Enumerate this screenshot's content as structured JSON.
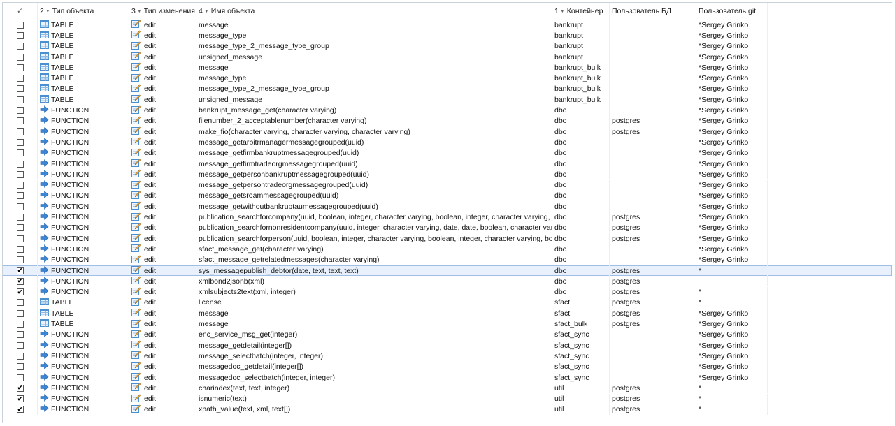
{
  "columns": {
    "check": "✓",
    "type_num": "2",
    "type_label": "Тип объекта",
    "change_num": "3",
    "change_label": "Тип изменения",
    "name_num": "4",
    "name_label": "Имя объекта",
    "container_num": "1",
    "container_label": "Контейнер",
    "dbuser_label": "Пользователь БД",
    "gituser_label": "Пользователь git"
  },
  "icons": {
    "table": "table-icon",
    "function": "function-arrow-icon",
    "edit": "edit-pencil-icon",
    "sort": "sort-triangle-icon"
  },
  "colors": {
    "selected_row": "#e8f0fb",
    "selected_border": "#9fbde6",
    "grid_line": "#eceef1",
    "function_icon": "#3b86d6"
  },
  "rows": [
    {
      "checked": false,
      "type": "TABLE",
      "change": "edit",
      "name": "message",
      "container": "bankrupt",
      "db_user": "",
      "git_user": "*Sergey Grinko"
    },
    {
      "checked": false,
      "type": "TABLE",
      "change": "edit",
      "name": "message_type",
      "container": "bankrupt",
      "db_user": "",
      "git_user": "*Sergey Grinko"
    },
    {
      "checked": false,
      "type": "TABLE",
      "change": "edit",
      "name": "message_type_2_message_type_group",
      "container": "bankrupt",
      "db_user": "",
      "git_user": "*Sergey Grinko"
    },
    {
      "checked": false,
      "type": "TABLE",
      "change": "edit",
      "name": "unsigned_message",
      "container": "bankrupt",
      "db_user": "",
      "git_user": "*Sergey Grinko"
    },
    {
      "checked": false,
      "type": "TABLE",
      "change": "edit",
      "name": "message",
      "container": "bankrupt_bulk",
      "db_user": "",
      "git_user": "*Sergey Grinko"
    },
    {
      "checked": false,
      "type": "TABLE",
      "change": "edit",
      "name": "message_type",
      "container": "bankrupt_bulk",
      "db_user": "",
      "git_user": "*Sergey Grinko"
    },
    {
      "checked": false,
      "type": "TABLE",
      "change": "edit",
      "name": "message_type_2_message_type_group",
      "container": "bankrupt_bulk",
      "db_user": "",
      "git_user": "*Sergey Grinko"
    },
    {
      "checked": false,
      "type": "TABLE",
      "change": "edit",
      "name": "unsigned_message",
      "container": "bankrupt_bulk",
      "db_user": "",
      "git_user": "*Sergey Grinko"
    },
    {
      "checked": false,
      "type": "FUNCTION",
      "change": "edit",
      "name": "bankrupt_message_get(character varying)",
      "container": "dbo",
      "db_user": "",
      "git_user": "*Sergey Grinko"
    },
    {
      "checked": false,
      "type": "FUNCTION",
      "change": "edit",
      "name": "filenumber_2_acceptablenumber(character varying)",
      "container": "dbo",
      "db_user": "postgres",
      "git_user": "*Sergey Grinko"
    },
    {
      "checked": false,
      "type": "FUNCTION",
      "change": "edit",
      "name": "make_fio(character varying, character varying, character varying)",
      "container": "dbo",
      "db_user": "postgres",
      "git_user": "*Sergey Grinko"
    },
    {
      "checked": false,
      "type": "FUNCTION",
      "change": "edit",
      "name": "message_getarbitrmanagermessagegrouped(uuid)",
      "container": "dbo",
      "db_user": "",
      "git_user": "*Sergey Grinko"
    },
    {
      "checked": false,
      "type": "FUNCTION",
      "change": "edit",
      "name": "message_getfirmbankruptmessagegrouped(uuid)",
      "container": "dbo",
      "db_user": "",
      "git_user": "*Sergey Grinko"
    },
    {
      "checked": false,
      "type": "FUNCTION",
      "change": "edit",
      "name": "message_getfirmtradeorgmessagegrouped(uuid)",
      "container": "dbo",
      "db_user": "",
      "git_user": "*Sergey Grinko"
    },
    {
      "checked": false,
      "type": "FUNCTION",
      "change": "edit",
      "name": "message_getpersonbankruptmessagegrouped(uuid)",
      "container": "dbo",
      "db_user": "",
      "git_user": "*Sergey Grinko"
    },
    {
      "checked": false,
      "type": "FUNCTION",
      "change": "edit",
      "name": "message_getpersontradeorgmessagegrouped(uuid)",
      "container": "dbo",
      "db_user": "",
      "git_user": "*Sergey Grinko"
    },
    {
      "checked": false,
      "type": "FUNCTION",
      "change": "edit",
      "name": "message_getsroammessagegrouped(uuid)",
      "container": "dbo",
      "db_user": "",
      "git_user": "*Sergey Grinko"
    },
    {
      "checked": false,
      "type": "FUNCTION",
      "change": "edit",
      "name": "message_getwithoutbankruptaumessagegrouped(uuid)",
      "container": "dbo",
      "db_user": "",
      "git_user": "*Sergey Grinko"
    },
    {
      "checked": false,
      "type": "FUNCTION",
      "change": "edit",
      "name": "publication_searchforcompany(uuid, boolean, integer, character varying, boolean, integer, character varying, bo",
      "container": "dbo",
      "db_user": "postgres",
      "git_user": "*Sergey Grinko"
    },
    {
      "checked": false,
      "type": "FUNCTION",
      "change": "edit",
      "name": "publication_searchfornonresidentcompany(uuid, integer, character varying, date, date, boolean, character varyir",
      "container": "dbo",
      "db_user": "postgres",
      "git_user": "*Sergey Grinko"
    },
    {
      "checked": false,
      "type": "FUNCTION",
      "change": "edit",
      "name": "publication_searchforperson(uuid, boolean, integer, character varying, boolean, integer, character varying, boole",
      "container": "dbo",
      "db_user": "postgres",
      "git_user": "*Sergey Grinko"
    },
    {
      "checked": false,
      "type": "FUNCTION",
      "change": "edit",
      "name": "sfact_message_get(character varying)",
      "container": "dbo",
      "db_user": "",
      "git_user": "*Sergey Grinko"
    },
    {
      "checked": false,
      "type": "FUNCTION",
      "change": "edit",
      "name": "sfact_message_getrelatedmessages(character varying)",
      "container": "dbo",
      "db_user": "",
      "git_user": "*Sergey Grinko"
    },
    {
      "checked": true,
      "selected": true,
      "type": "FUNCTION",
      "change": "edit",
      "name": "sys_messagepublish_debtor(date, text, text, text)",
      "container": "dbo",
      "db_user": "postgres",
      "git_user": "*"
    },
    {
      "checked": true,
      "type": "FUNCTION",
      "change": "edit",
      "name": "xmlbond2jsonb(xml)",
      "container": "dbo",
      "db_user": "postgres",
      "git_user": ""
    },
    {
      "checked": true,
      "type": "FUNCTION",
      "change": "edit",
      "name": "xmlsubjects2text(xml, integer)",
      "container": "dbo",
      "db_user": "postgres",
      "git_user": "*"
    },
    {
      "checked": false,
      "type": "TABLE",
      "change": "edit",
      "name": "license",
      "container": "sfact",
      "db_user": "postgres",
      "git_user": "*"
    },
    {
      "checked": false,
      "type": "TABLE",
      "change": "edit",
      "name": "message",
      "container": "sfact",
      "db_user": "postgres",
      "git_user": "*Sergey Grinko"
    },
    {
      "checked": false,
      "type": "TABLE",
      "change": "edit",
      "name": "message",
      "container": "sfact_bulk",
      "db_user": "postgres",
      "git_user": "*Sergey Grinko"
    },
    {
      "checked": false,
      "type": "FUNCTION",
      "change": "edit",
      "name": "enc_service_msg_get(integer)",
      "container": "sfact_sync",
      "db_user": "",
      "git_user": "*Sergey Grinko"
    },
    {
      "checked": false,
      "type": "FUNCTION",
      "change": "edit",
      "name": "message_getdetail(integer[])",
      "container": "sfact_sync",
      "db_user": "",
      "git_user": "*Sergey Grinko"
    },
    {
      "checked": false,
      "type": "FUNCTION",
      "change": "edit",
      "name": "message_selectbatch(integer, integer)",
      "container": "sfact_sync",
      "db_user": "",
      "git_user": "*Sergey Grinko"
    },
    {
      "checked": false,
      "type": "FUNCTION",
      "change": "edit",
      "name": "messagedoc_getdetail(integer[])",
      "container": "sfact_sync",
      "db_user": "",
      "git_user": "*Sergey Grinko"
    },
    {
      "checked": false,
      "type": "FUNCTION",
      "change": "edit",
      "name": "messagedoc_selectbatch(integer, integer)",
      "container": "sfact_sync",
      "db_user": "",
      "git_user": "*Sergey Grinko"
    },
    {
      "checked": true,
      "type": "FUNCTION",
      "change": "edit",
      "name": "charindex(text, text, integer)",
      "container": "util",
      "db_user": "postgres",
      "git_user": "*"
    },
    {
      "checked": true,
      "type": "FUNCTION",
      "change": "edit",
      "name": "isnumeric(text)",
      "container": "util",
      "db_user": "postgres",
      "git_user": "*"
    },
    {
      "checked": true,
      "type": "FUNCTION",
      "change": "edit",
      "name": "xpath_value(text, xml, text[])",
      "container": "util",
      "db_user": "postgres",
      "git_user": "*"
    }
  ]
}
